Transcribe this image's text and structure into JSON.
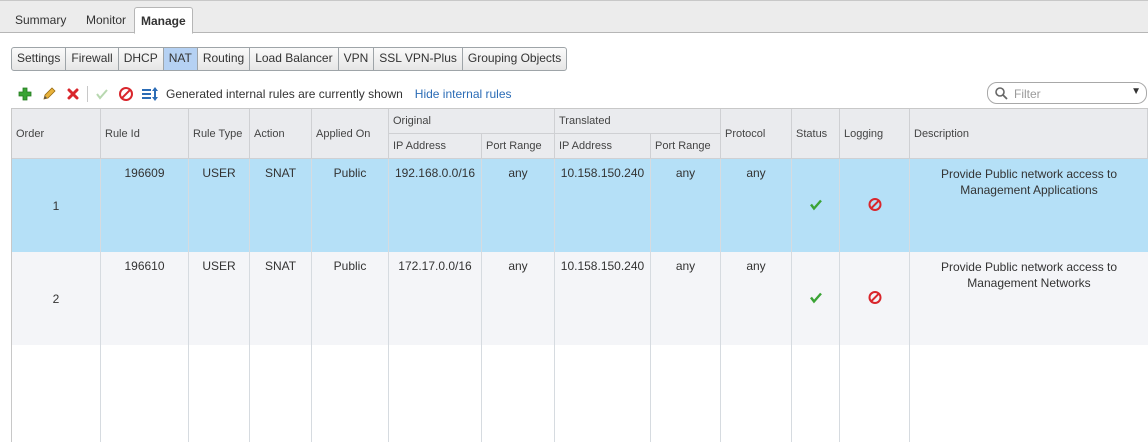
{
  "top_tabs": [
    "Summary",
    "Monitor",
    "Manage"
  ],
  "top_tabs_active": "Manage",
  "sub_tabs": [
    "Settings",
    "Firewall",
    "DHCP",
    "NAT",
    "Routing",
    "Load Balancer",
    "VPN",
    "SSL VPN-Plus",
    "Grouping Objects"
  ],
  "sub_tabs_active": "NAT",
  "toolbar": {
    "icons": [
      "add-icon",
      "edit-icon",
      "delete-icon",
      "enable-icon",
      "disable-icon",
      "move-icon"
    ],
    "status_text": "Generated internal rules are currently shown",
    "toggle_link": "Hide internal rules"
  },
  "filter": {
    "placeholder": "Filter"
  },
  "columns": {
    "order": "Order",
    "rule_id": "Rule Id",
    "rule_type": "Rule Type",
    "action": "Action",
    "applied_on": "Applied On",
    "original": "Original",
    "translated": "Translated",
    "ip_address": "IP Address",
    "port_range": "Port Range",
    "protocol": "Protocol",
    "status": "Status",
    "logging": "Logging",
    "description": "Description"
  },
  "rows": [
    {
      "order": "1",
      "rule_id": "196609",
      "rule_type": "USER",
      "action": "SNAT",
      "applied_on": "Public",
      "orig_ip": "192.168.0.0/16",
      "orig_port": "any",
      "trans_ip": "10.158.150.240",
      "trans_port": "any",
      "protocol": "any",
      "status": "enabled",
      "logging": "disabled",
      "description": "Provide Public network access to Management Applications"
    },
    {
      "order": "2",
      "rule_id": "196610",
      "rule_type": "USER",
      "action": "SNAT",
      "applied_on": "Public",
      "orig_ip": "172.17.0.0/16",
      "orig_port": "any",
      "trans_ip": "10.158.150.240",
      "trans_port": "any",
      "protocol": "any",
      "status": "enabled",
      "logging": "disabled",
      "description": "Provide Public network access to Management Networks"
    }
  ],
  "colors": {
    "selected_row": "#b5e0f7",
    "active_subtab": "#b5d1f3",
    "link": "#2b6cb6",
    "check": "#3aa335",
    "forbid": "#d9262c"
  }
}
